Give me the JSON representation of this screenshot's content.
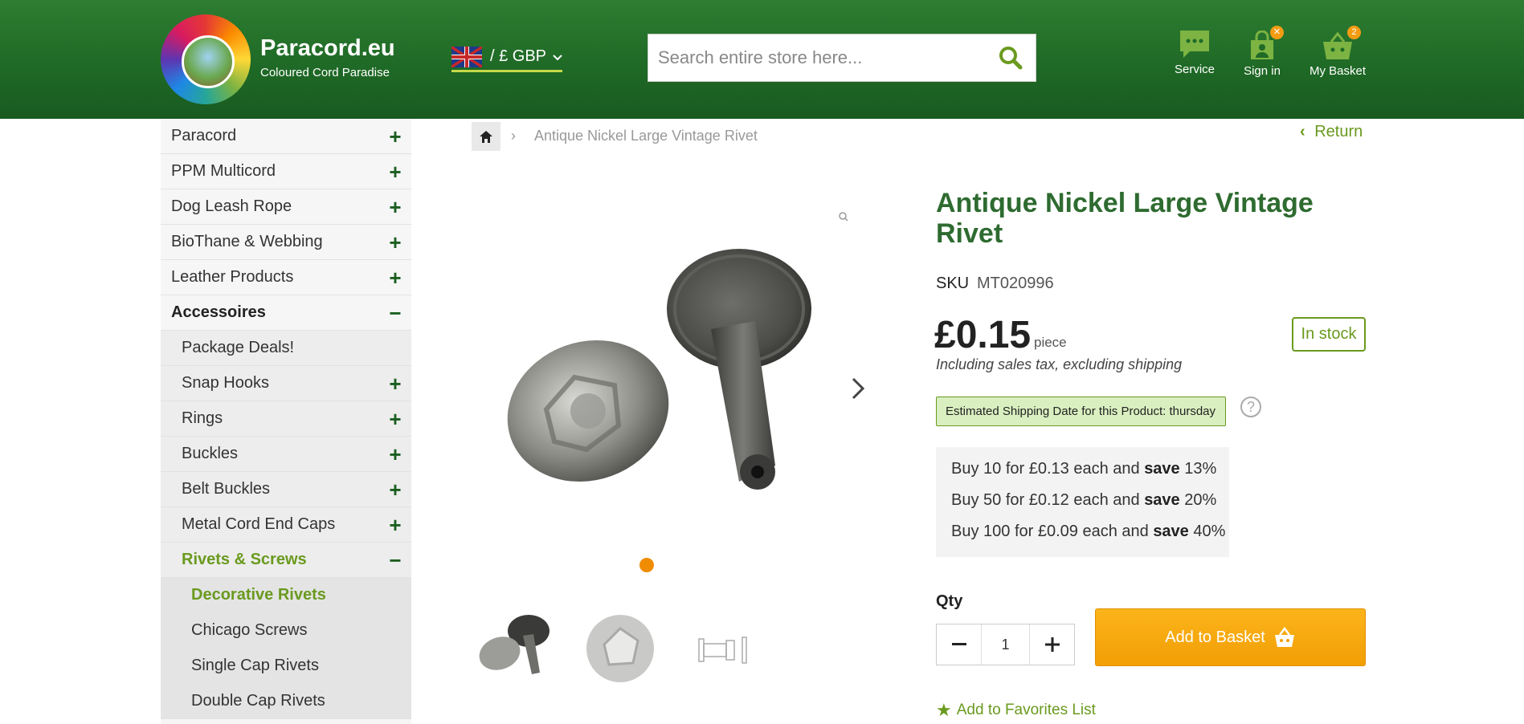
{
  "header": {
    "brand_name": "Paracord.eu",
    "brand_tagline": "Coloured Cord Paradise",
    "currency": "/ £ GBP",
    "search_placeholder": "Search entire store here...",
    "service_label": "Service",
    "signin_label": "Sign in",
    "basket_label": "My Basket",
    "basket_count": "2"
  },
  "sidebar": {
    "items": [
      {
        "label": "Paracord",
        "toggle": "+"
      },
      {
        "label": "PPM Multicord",
        "toggle": "+"
      },
      {
        "label": "Dog Leash Rope",
        "toggle": "+"
      },
      {
        "label": "BioThane & Webbing",
        "toggle": "+"
      },
      {
        "label": "Leather Products",
        "toggle": "+"
      },
      {
        "label": "Accessoires",
        "toggle": "−"
      },
      {
        "label": "Package Deals!",
        "toggle": ""
      },
      {
        "label": "Snap Hooks",
        "toggle": "+"
      },
      {
        "label": "Rings",
        "toggle": "+"
      },
      {
        "label": "Buckles",
        "toggle": "+"
      },
      {
        "label": "Belt Buckles",
        "toggle": "+"
      },
      {
        "label": "Metal Cord End Caps",
        "toggle": "+"
      },
      {
        "label": "Rivets & Screws",
        "toggle": "−"
      },
      {
        "label": "Decorative Rivets",
        "toggle": ""
      },
      {
        "label": "Chicago Screws",
        "toggle": ""
      },
      {
        "label": "Single Cap Rivets",
        "toggle": ""
      },
      {
        "label": "Double Cap Rivets",
        "toggle": ""
      }
    ]
  },
  "breadcrumb": {
    "separator": "›",
    "current": "Antique Nickel Large Vintage Rivet",
    "return_label": "Return"
  },
  "product": {
    "title": "Antique Nickel Large Vintage Rivet",
    "sku_label": "SKU",
    "sku": "MT020996",
    "price": "£0.15",
    "price_unit": "piece",
    "tax_note": "Including sales tax, excluding shipping",
    "stock": "In stock",
    "shipping_date": "Estimated Shipping Date for this Product: thursday",
    "help": "?",
    "tiers": [
      {
        "pre": "Buy 10 for £0.13 each and ",
        "save": "save",
        "pct": " 13%"
      },
      {
        "pre": "Buy 50 for £0.12 each and ",
        "save": "save",
        "pct": " 20%"
      },
      {
        "pre": "Buy 100 for £0.09 each and ",
        "save": "save",
        "pct": " 40%"
      }
    ],
    "qty_label": "Qty",
    "qty_value": "1",
    "add_to_basket": "Add to Basket",
    "favorites": "Add to Favorites List"
  },
  "colors": {
    "header_green": "#2e7d32",
    "accent_green": "#6a9a1f",
    "title_green": "#2e6b30",
    "orange": "#f29e05"
  }
}
